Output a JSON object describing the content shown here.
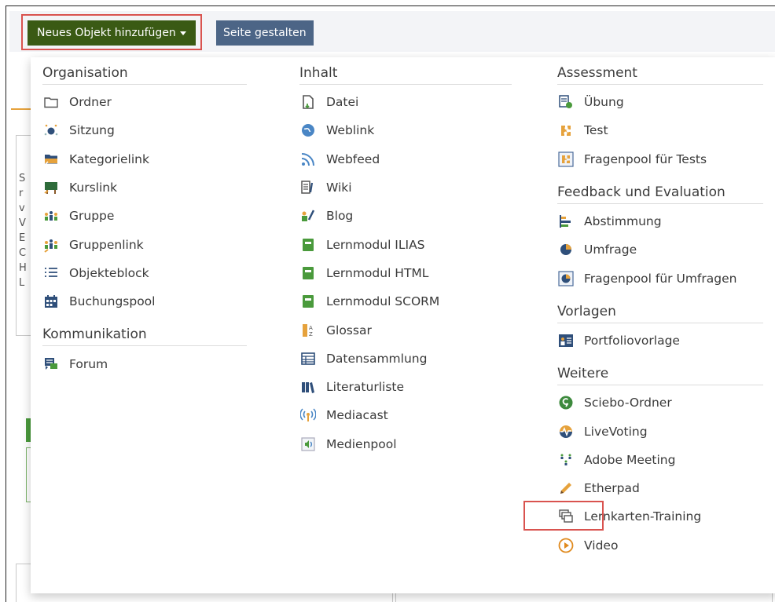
{
  "toolbar": {
    "new_object_label": "Neues Objekt hinzufügen",
    "layout_label": "Seite gestalten"
  },
  "background": {
    "left_letters": "S\nr\nv\nV\nE\nC\nH\nL"
  },
  "menu": {
    "columns": [
      {
        "groups": [
          {
            "title": "Organisation",
            "items": [
              {
                "label": "Ordner",
                "icon": "folder-icon"
              },
              {
                "label": "Sitzung",
                "icon": "session-icon"
              },
              {
                "label": "Kategorielink",
                "icon": "category-link-icon"
              },
              {
                "label": "Kurslink",
                "icon": "course-link-icon"
              },
              {
                "label": "Gruppe",
                "icon": "group-icon"
              },
              {
                "label": "Gruppenlink",
                "icon": "group-link-icon"
              },
              {
                "label": "Objekteblock",
                "icon": "object-block-icon"
              },
              {
                "label": "Buchungspool",
                "icon": "booking-pool-icon"
              }
            ]
          },
          {
            "title": "Kommunikation",
            "items": [
              {
                "label": "Forum",
                "icon": "forum-icon"
              }
            ]
          }
        ]
      },
      {
        "groups": [
          {
            "title": "Inhalt",
            "items": [
              {
                "label": "Datei",
                "icon": "file-icon"
              },
              {
                "label": "Weblink",
                "icon": "weblink-icon"
              },
              {
                "label": "Webfeed",
                "icon": "rss-icon"
              },
              {
                "label": "Wiki",
                "icon": "wiki-icon"
              },
              {
                "label": "Blog",
                "icon": "blog-icon"
              },
              {
                "label": "Lernmodul ILIAS",
                "icon": "learning-module-icon"
              },
              {
                "label": "Lernmodul HTML",
                "icon": "learning-module-icon"
              },
              {
                "label": "Lernmodul SCORM",
                "icon": "learning-module-icon"
              },
              {
                "label": "Glossar",
                "icon": "glossary-icon"
              },
              {
                "label": "Datensammlung",
                "icon": "data-collection-icon"
              },
              {
                "label": "Literaturliste",
                "icon": "bibliography-icon"
              },
              {
                "label": "Mediacast",
                "icon": "mediacast-icon"
              },
              {
                "label": "Medienpool",
                "icon": "media-pool-icon"
              }
            ]
          }
        ]
      },
      {
        "groups": [
          {
            "title": "Assessment",
            "items": [
              {
                "label": "Übung",
                "icon": "exercise-icon"
              },
              {
                "label": "Test",
                "icon": "test-icon"
              },
              {
                "label": "Fragenpool für Tests",
                "icon": "question-pool-icon"
              }
            ]
          },
          {
            "title": "Feedback und Evaluation",
            "items": [
              {
                "label": "Abstimmung",
                "icon": "poll-icon"
              },
              {
                "label": "Umfrage",
                "icon": "survey-icon"
              },
              {
                "label": "Fragenpool für Umfragen",
                "icon": "survey-pool-icon"
              }
            ]
          },
          {
            "title": "Vorlagen",
            "items": [
              {
                "label": "Portfoliovorlage",
                "icon": "portfolio-template-icon"
              }
            ]
          },
          {
            "title": "Weitere",
            "items": [
              {
                "label": "Sciebo-Ordner",
                "icon": "sciebo-icon"
              },
              {
                "label": "LiveVoting",
                "icon": "livevoting-icon"
              },
              {
                "label": "Adobe Meeting",
                "icon": "adobe-meeting-icon"
              },
              {
                "label": "Etherpad",
                "icon": "pencil-icon"
              },
              {
                "label": "Lernkarten-Training",
                "icon": "flashcards-icon"
              },
              {
                "label": "Video",
                "icon": "video-play-icon"
              }
            ]
          }
        ]
      }
    ]
  },
  "colors": {
    "new_button_bg": "#3a5a14",
    "layout_button_bg": "#4c6586",
    "highlight_border": "#d9534f",
    "accent_orange": "#e6a23c"
  }
}
